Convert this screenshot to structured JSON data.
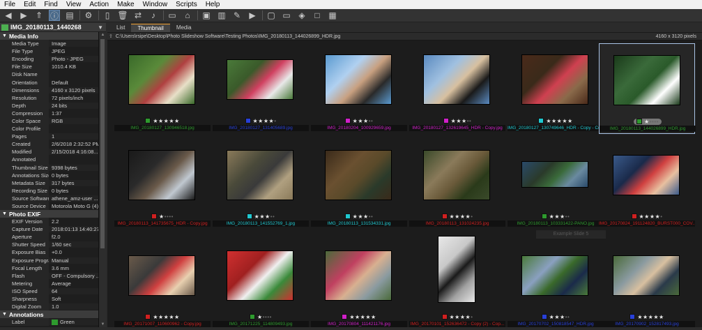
{
  "menu": [
    "File",
    "Edit",
    "Find",
    "View",
    "Action",
    "Make",
    "Window",
    "Scripts",
    "Help"
  ],
  "toolbar_icons": [
    "back-icon",
    "forward-icon",
    "up-icon",
    "info-icon",
    "filmstrip-icon",
    "settings-icon",
    "new-file-icon",
    "trash-icon",
    "transfer-icon",
    "mic-icon",
    "pages-icon",
    "home-icon",
    "slideshow-icon",
    "chart-icon",
    "brush-icon",
    "play-icon",
    "window-icon",
    "monitor-icon",
    "tag-icon",
    "square-icon",
    "grid-icon"
  ],
  "left": {
    "title": "IMG_20180113_1440268",
    "sections": [
      {
        "name": "Media Info",
        "rows": [
          [
            "Media Type",
            "Image"
          ],
          [
            "File Type",
            "JPEG"
          ],
          [
            "Encoding",
            "Photo - JPEG"
          ],
          [
            "File Size",
            "1010.4 KB"
          ],
          [
            "Disk Name",
            ""
          ],
          [
            "Orientation",
            "Default"
          ],
          [
            "Dimensions",
            "4160 x 3120 pixels"
          ],
          [
            "Resolution",
            "72 pixels/inch"
          ],
          [
            "Depth",
            "24 bits"
          ],
          [
            "Compression",
            "1:37"
          ],
          [
            "Color Space",
            "RGB"
          ],
          [
            "Color Profile",
            ""
          ],
          [
            "Pages",
            "1"
          ],
          [
            "Created",
            "2/6/2018 2:32:52 PM"
          ],
          [
            "Modified",
            "2/15/2018 4:16:08..."
          ],
          [
            "Annotated",
            ""
          ],
          [
            "Thumbnail Size",
            "9398 bytes"
          ],
          [
            "Annotations Size",
            "0 bytes"
          ],
          [
            "Metadata Size",
            "317 bytes"
          ],
          [
            "Recording Size",
            "0 bytes"
          ],
          [
            "Source Software",
            "athene_amz-user ..."
          ],
          [
            "Source Device",
            "Motorola Moto G (4)"
          ]
        ]
      },
      {
        "name": "Photo EXIF",
        "rows": [
          [
            "EXIF Version",
            "2.2"
          ],
          [
            "Capture Date",
            "2018:01:13 14:40:27"
          ],
          [
            "Aperture",
            "f2.0"
          ],
          [
            "Shutter Speed",
            "1/60 sec"
          ],
          [
            "Exposure Bias",
            "+0.0"
          ],
          [
            "Exposure Program",
            "Manual"
          ],
          [
            "Focal Length",
            "3.6 mm"
          ],
          [
            "Flash",
            "OFF - Compulsory ..."
          ],
          [
            "Metering",
            "Average"
          ],
          [
            "ISO Speed",
            "64"
          ],
          [
            "Sharpness",
            "Soft"
          ],
          [
            "Digital Zoom",
            "1.0"
          ]
        ]
      },
      {
        "name": "Annotations",
        "rows": [
          [
            "Label",
            "Green"
          ]
        ]
      }
    ]
  },
  "tabs": [
    "List",
    "Thumbnail",
    "Media"
  ],
  "selected_tab": "Thumbnail",
  "path": "C:\\Users\\rsipe\\Desktop\\Photo Slideshow Software\\Testing Photos\\IMG_20180113_144026899_HDR.jpg",
  "dimensions": "4160 x 3120 pixels",
  "ghost_text": "Example Slide 5",
  "colors": {
    "green": "#2e9a2e",
    "blue": "#2840d8",
    "magenta": "#d020c8",
    "cyan": "#20c8d0",
    "red": "#d02020"
  },
  "thumbs": [
    {
      "name": "IMG_20180127_130946518.jpg",
      "label": "green",
      "stars": 5
    },
    {
      "name": "IMG_20180127_131405689.jpg",
      "label": "blue",
      "stars": 4
    },
    {
      "name": "IMG_20180204_100929659.jpg",
      "label": "magenta",
      "stars": 3
    },
    {
      "name": "IMG_20180127_132619645_HDR - Copy.jpg",
      "label": "magenta",
      "stars": 3
    },
    {
      "name": "IMG_20180127_130749646_HDR - Copy - Co...",
      "label": "cyan",
      "stars": 5
    },
    {
      "name": "IMG_20180113_144026899_HDR.jpg",
      "label": "green",
      "stars": 1
    },
    {
      "name": "IMG_20180113_141735675_HDR - Copy.jpg",
      "label": "red",
      "stars": 1
    },
    {
      "name": "IMG_20180113_141552769_1.jpg",
      "label": "cyan",
      "stars": 3
    },
    {
      "name": "IMG_20180113_131534331.jpg",
      "label": "cyan",
      "stars": 3
    },
    {
      "name": "IMG_20180113_131024235.jpg",
      "label": "red",
      "stars": 4
    },
    {
      "name": "IMG_20180113_103331422-PANO.jpg",
      "label": "green",
      "stars": 3
    },
    {
      "name": "IMG_20170824_191124820_BURST000_COV...",
      "label": "red",
      "stars": 4
    },
    {
      "name": "IMG_20171007_110600962 - Copy.jpg",
      "label": "red",
      "stars": 5
    },
    {
      "name": "IMG_20171225_114809493.jpg",
      "label": "green",
      "stars": 1
    },
    {
      "name": "IMG_20170804_111421176.jpg",
      "label": "magenta",
      "stars": 5
    },
    {
      "name": "IMG_20170101_152636472 - Copy (2) - Cop...",
      "label": "red",
      "stars": 4
    },
    {
      "name": "IMG_20170702_150818547_HDR.jpg",
      "label": "blue",
      "stars": 3
    },
    {
      "name": "IMG_20170902_152817493.jpg",
      "label": "blue",
      "stars": 5
    }
  ]
}
